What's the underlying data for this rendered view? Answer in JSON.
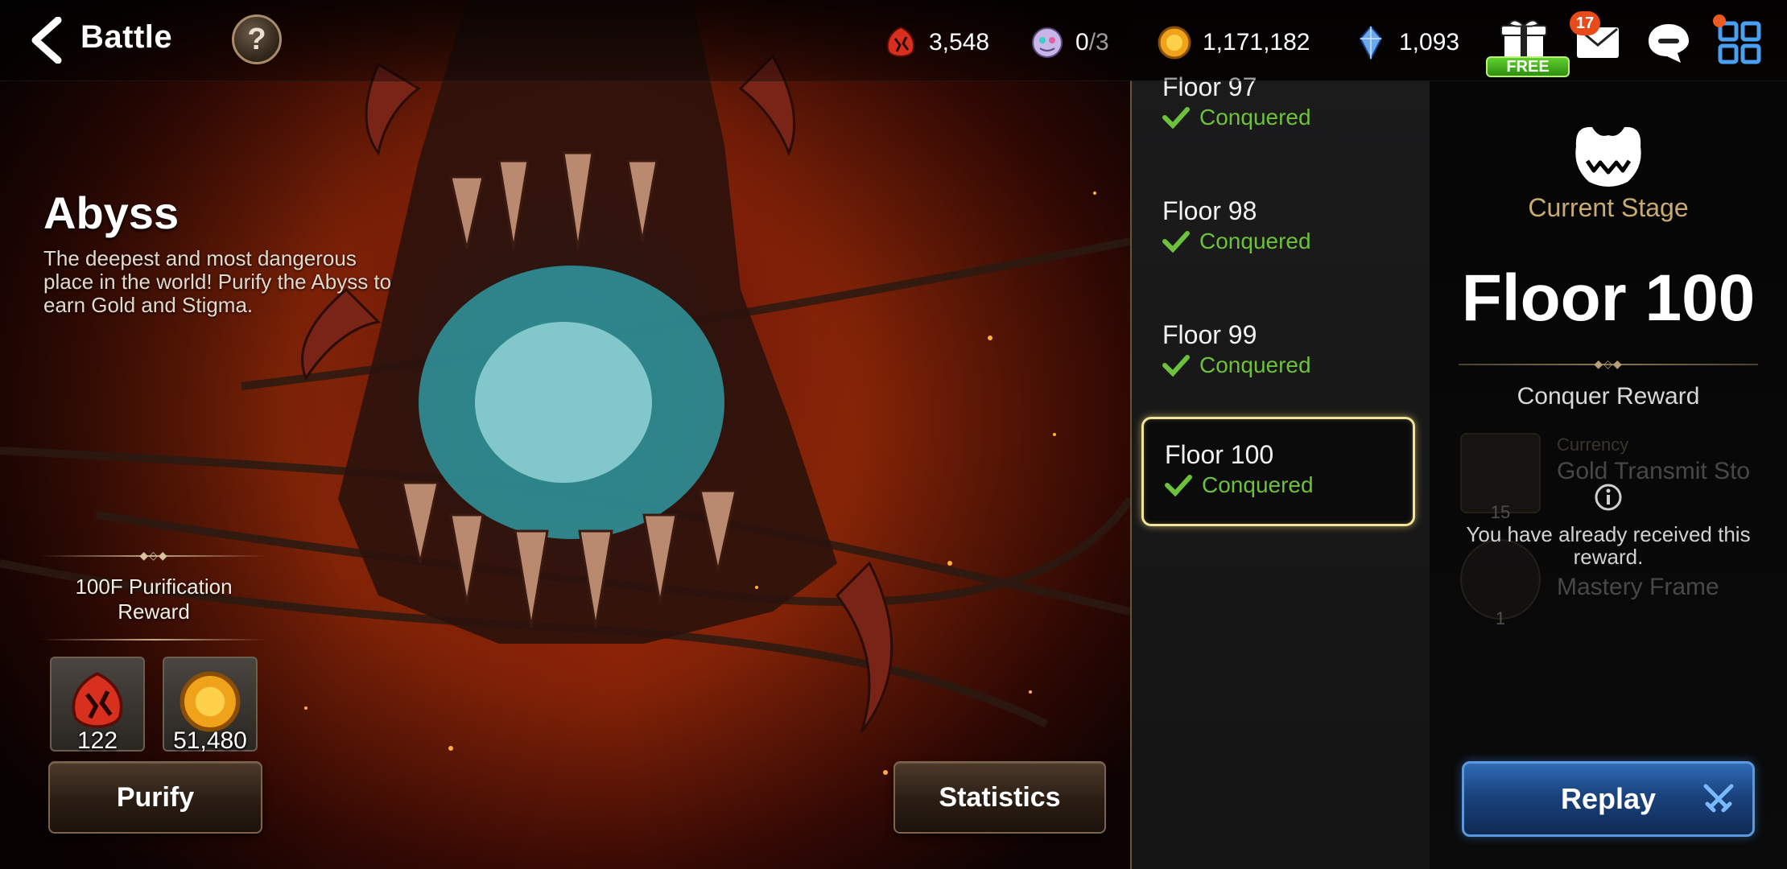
{
  "header": {
    "title": "Battle",
    "help": "?",
    "resources": [
      {
        "icon": "stigma-icon",
        "value": "3,548"
      },
      {
        "icon": "hunt-ticket-icon",
        "value": "0",
        "max": "/3"
      },
      {
        "icon": "gold-icon",
        "value": "1,171,182"
      },
      {
        "icon": "skystone-icon",
        "value": "1,093"
      }
    ],
    "free_label": "FREE",
    "mail_badge": "17"
  },
  "abyss": {
    "name": "Abyss",
    "description": "The deepest and most dangerous place in the world! Purify the Abyss to earn Gold and Stigma."
  },
  "purification": {
    "title": "100F Purification Reward",
    "items": [
      {
        "icon": "stigma-icon",
        "qty": "122"
      },
      {
        "icon": "gold-icon",
        "qty": "51,480"
      }
    ],
    "purify_label": "Purify"
  },
  "statistics_label": "Statistics",
  "floors": [
    {
      "name": "Floor 97",
      "status": "Conquered"
    },
    {
      "name": "Floor 98",
      "status": "Conquered"
    },
    {
      "name": "Floor 99",
      "status": "Conquered"
    },
    {
      "name": "Floor 100",
      "status": "Conquered",
      "selected": true
    }
  ],
  "stage": {
    "label": "Current Stage",
    "floor": "Floor 100",
    "conquer_reward_label": "Conquer Reward",
    "rewards": [
      {
        "category": "Currency",
        "item": "Gold Transmit Sto",
        "count": "15"
      },
      {
        "category": "",
        "item": "Mastery Frame",
        "count": "1"
      }
    ],
    "received_message": "You have already received this reward.",
    "replay_label": "Replay"
  },
  "colors": {
    "conquered": "#6ec13a",
    "selected_border": "#f0e39a",
    "stage_gold": "#c9ab72",
    "replay_blue": "#1a437e"
  }
}
